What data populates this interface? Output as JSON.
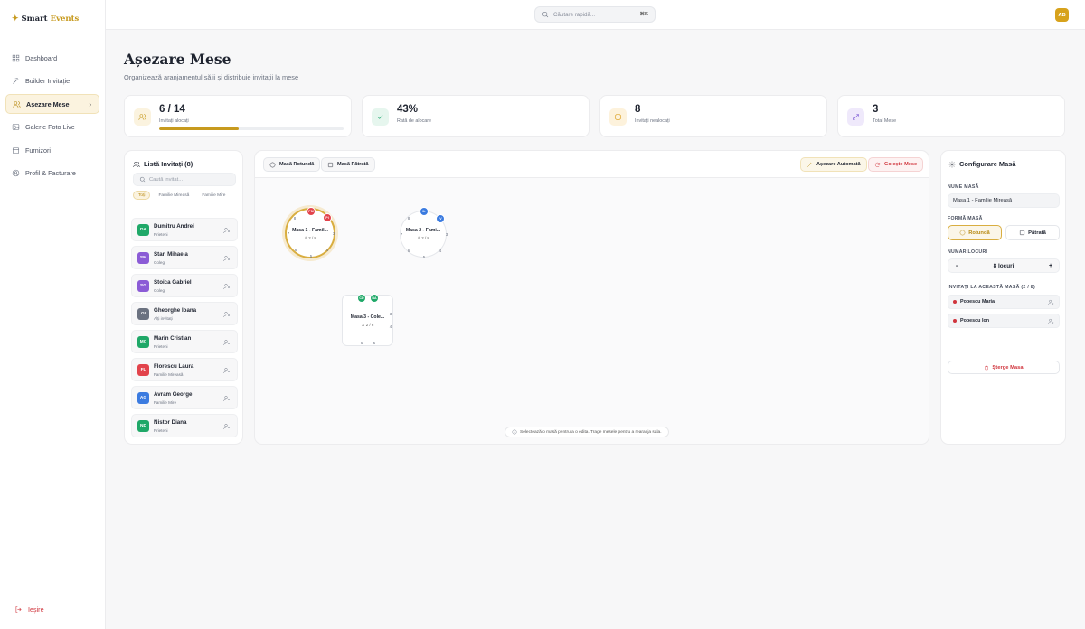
{
  "brand": {
    "part1": "Smart",
    "part2": "Events"
  },
  "nav": [
    {
      "label": "Dashboard",
      "icon": "grid-icon"
    },
    {
      "label": "Builder Invitație",
      "icon": "wand-icon"
    },
    {
      "label": "Așezare Mese",
      "icon": "users-icon",
      "active": true
    },
    {
      "label": "Galerie Foto Live",
      "icon": "image-icon"
    },
    {
      "label": "Furnizori",
      "icon": "store-icon"
    },
    {
      "label": "Profil & Facturare",
      "icon": "user-circle-icon"
    }
  ],
  "logout": "Ieșire",
  "search": {
    "placeholder": "Căutare rapidă...",
    "shortcut": "⌘K"
  },
  "user": {
    "initials": "AB"
  },
  "page": {
    "title": "Așezare Mese",
    "subtitle": "Organizează aranjamentul sălii și distribuie invitații la mese"
  },
  "stats": [
    {
      "value": "6 / 14",
      "label": "Invitați alocați",
      "progress": 0.43,
      "color": "#c79a1e"
    },
    {
      "value": "43%",
      "label": "Rată de alocare",
      "color": "#16a36a"
    },
    {
      "value": "8",
      "label": "Invitați nealocați",
      "color": "#d99a12"
    },
    {
      "value": "3",
      "label": "Total Mese",
      "color": "#7c5bd6"
    }
  ],
  "guestList": {
    "title": "Listă Invitați (8)",
    "searchPlaceholder": "Caută invitat...",
    "filters": [
      "Toți",
      "Familie Mireasă",
      "Familie Mire"
    ],
    "guests": [
      {
        "initials": "DA",
        "name": "Dumitru Andrei",
        "group": "Prieteni",
        "color": "#1fa868"
      },
      {
        "initials": "SM",
        "name": "Stan Mihaela",
        "group": "Colegi",
        "color": "#8b5bd6"
      },
      {
        "initials": "SG",
        "name": "Stoica Gabriel",
        "group": "Colegi",
        "color": "#8b5bd6"
      },
      {
        "initials": "GI",
        "name": "Gheorghe Ioana",
        "group": "Alți invitați",
        "color": "#6b7280"
      },
      {
        "initials": "MC",
        "name": "Marin Cristian",
        "group": "Prieteni",
        "color": "#1fa868"
      },
      {
        "initials": "FL",
        "name": "Florescu Laura",
        "group": "Familie Mireasă",
        "color": "#e2434b"
      },
      {
        "initials": "AG",
        "name": "Avram George",
        "group": "Familie Mire",
        "color": "#3b7be0"
      },
      {
        "initials": "ND",
        "name": "Nistor Diana",
        "group": "Prieteni",
        "color": "#1fa868"
      }
    ]
  },
  "toolbar": {
    "roundTable": "Masă Rotundă",
    "squareTable": "Masă Pătrată",
    "autoSeat": "Așezare Automată",
    "clearTables": "Golește Mese"
  },
  "tables": [
    {
      "name": "Masa 1 - Famil...",
      "count": "2 / 8",
      "seats": [
        "8",
        "7",
        "6",
        "5",
        "4",
        "3"
      ],
      "avatars": [
        {
          "initials": "PM",
          "color": "#e2434b"
        },
        {
          "initials": "PI",
          "color": "#e2434b"
        }
      ]
    },
    {
      "name": "Masa 2 - Fami...",
      "count": "2 / 8",
      "seats": [
        "8",
        "7",
        "6",
        "5",
        "4",
        "3"
      ],
      "avatars": [
        {
          "initials": "IL",
          "color": "#3b7be0"
        },
        {
          "initials": "IV",
          "color": "#3b7be0"
        }
      ]
    },
    {
      "name": "Masa 3 - Cole...",
      "count": "2 / 6",
      "seats": [
        "3",
        "4",
        "6",
        "5"
      ],
      "avatars": [
        {
          "initials": "CD",
          "color": "#1fa868"
        },
        {
          "initials": "BA",
          "color": "#1fa868"
        }
      ]
    }
  ],
  "hint": "Selectează o masă pentru a o edita. Trage mesele pentru a rearanja sala.",
  "config": {
    "title": "Configurare Masă",
    "nameLabel": "NUME MASĂ",
    "nameValue": "Masa 1 - Familie Mireasă",
    "shapeLabel": "FORMĂ MASĂ",
    "shapeRound": "Rotundă",
    "shapeSquare": "Pătrată",
    "seatsLabel": "NUMĂR LOCURI",
    "seatsValue": "8 locuri",
    "minus": "-",
    "plus": "+",
    "assignedLabel": "INVITAȚI LA ACEASTĂ MASĂ (2 / 8)",
    "assigned": [
      "Popescu Maria",
      "Popescu Ion"
    ],
    "deleteLabel": "Șterge Masa"
  }
}
